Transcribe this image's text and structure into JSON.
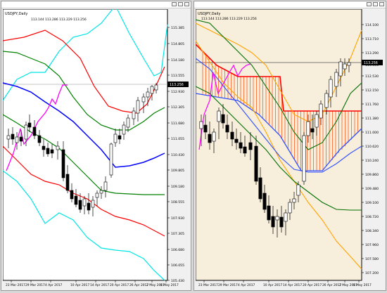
{
  "left_chart": {
    "symbol_line": "USDJPY,Daily",
    "ohlc_line": "113.144 113.286 113.229 113.256",
    "price_tag": "113.256",
    "y_labels": [
      "115.385",
      "114.805",
      "114.180",
      "113.555",
      "112.930",
      "112.305",
      "111.680",
      "111.055",
      "110.430",
      "109.805",
      "109.180",
      "108.555",
      "107.930",
      "107.305",
      "106.680",
      "106.055",
      "105.430"
    ],
    "x_labels": [
      "23 Mar 2017",
      "29 Mar 2017",
      "4 Apr 2017",
      "10 Apr 2017",
      "14 Apr 2017",
      "20 Apr 2017",
      "26 Apr 2017",
      "2 May 2017",
      "8 May 2017"
    ],
    "colors": {
      "bg": "#ffffff",
      "bull": "#000000",
      "bear": "#000000",
      "close_line": "#b0b0b0",
      "band1": "#ff0000",
      "band2": "#00e5e5",
      "band3": "#008000",
      "mid": "#0000ff",
      "lag": "#ff00ff"
    }
  },
  "right_chart": {
    "symbol_line": "USDJPY,Daily",
    "ohlc_line": "113.144 113.286 113.229 113.256",
    "price_tag": "113.256",
    "y_labels": [
      "114.100",
      "113.710",
      "113.290",
      "113.000",
      "112.530",
      "112.150",
      "111.760",
      "111.380",
      "111.000",
      "110.620",
      "110.240",
      "109.860",
      "109.480",
      "109.100",
      "108.720",
      "108.340",
      "107.960",
      "107.580",
      "107.200"
    ],
    "x_labels": [
      "23 Mar 2017",
      "29 Mar 2017",
      "4 Apr 2017",
      "10 Apr 2017",
      "14 Apr 2017",
      "20 Apr 2017",
      "26 Apr 2017",
      "2 May 2017",
      "8 May 2017"
    ],
    "colors": {
      "bg": "#f7eedc",
      "bull": "#ffffff",
      "bear": "#000000",
      "orange": "#ffa500",
      "green": "#007000",
      "blue": "#3050ff",
      "red": "#ff0000",
      "lag": "#ff00ff",
      "cloud": "#ff4500"
    }
  }
}
